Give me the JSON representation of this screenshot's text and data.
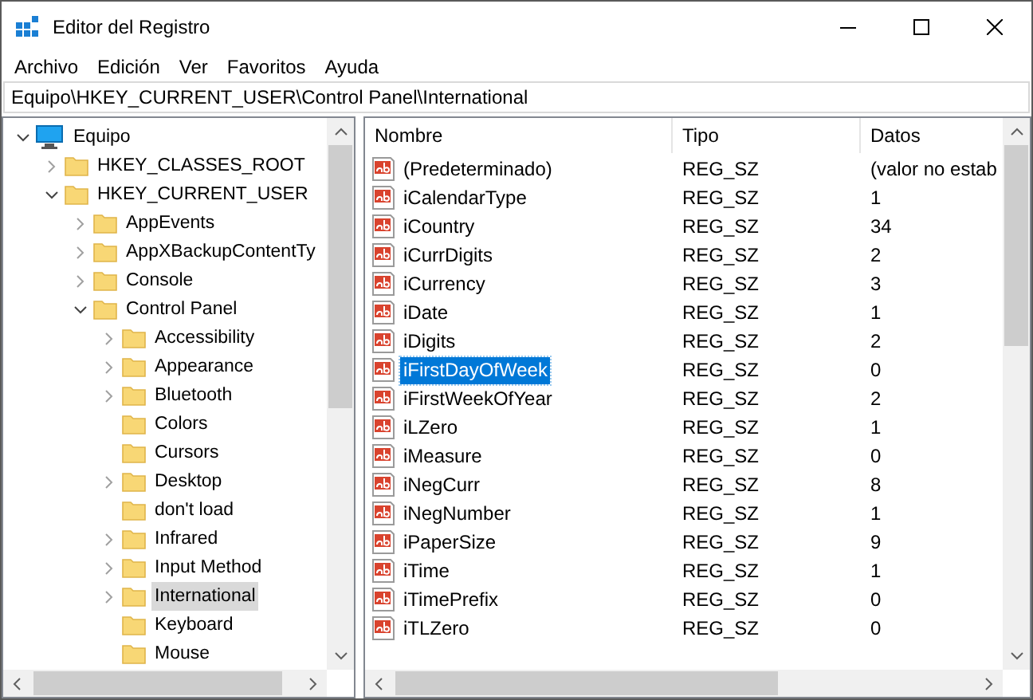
{
  "window": {
    "title": "Editor del Registro"
  },
  "menu": [
    "Archivo",
    "Edición",
    "Ver",
    "Favoritos",
    "Ayuda"
  ],
  "address": "Equipo\\HKEY_CURRENT_USER\\Control Panel\\International",
  "tree": [
    {
      "label": "Equipo",
      "kind": "computer",
      "expanded": true,
      "selected": false,
      "children": [
        {
          "label": "HKEY_CLASSES_ROOT",
          "kind": "folder",
          "expandable": true,
          "expanded": false,
          "selected": false
        },
        {
          "label": "HKEY_CURRENT_USER",
          "kind": "folder",
          "expanded": true,
          "selected": false,
          "children": [
            {
              "label": "AppEvents",
              "kind": "folder",
              "expandable": true,
              "expanded": false,
              "selected": false
            },
            {
              "label": "AppXBackupContentTy",
              "kind": "folder",
              "expandable": true,
              "expanded": false,
              "selected": false
            },
            {
              "label": "Console",
              "kind": "folder",
              "expandable": true,
              "expanded": false,
              "selected": false
            },
            {
              "label": "Control Panel",
              "kind": "folder",
              "expanded": true,
              "selected": false,
              "children": [
                {
                  "label": "Accessibility",
                  "kind": "folder",
                  "expandable": true,
                  "expanded": false,
                  "selected": false
                },
                {
                  "label": "Appearance",
                  "kind": "folder",
                  "expandable": true,
                  "expanded": false,
                  "selected": false
                },
                {
                  "label": "Bluetooth",
                  "kind": "folder",
                  "expandable": true,
                  "expanded": false,
                  "selected": false
                },
                {
                  "label": "Colors",
                  "kind": "folder",
                  "expandable": false,
                  "selected": false
                },
                {
                  "label": "Cursors",
                  "kind": "folder",
                  "expandable": false,
                  "selected": false
                },
                {
                  "label": "Desktop",
                  "kind": "folder",
                  "expandable": true,
                  "expanded": false,
                  "selected": false
                },
                {
                  "label": "don't load",
                  "kind": "folder",
                  "expandable": false,
                  "selected": false
                },
                {
                  "label": "Infrared",
                  "kind": "folder",
                  "expandable": true,
                  "expanded": false,
                  "selected": false
                },
                {
                  "label": "Input Method",
                  "kind": "folder",
                  "expandable": true,
                  "expanded": false,
                  "selected": false
                },
                {
                  "label": "International",
                  "kind": "folder",
                  "expandable": true,
                  "expanded": false,
                  "selected": true
                },
                {
                  "label": "Keyboard",
                  "kind": "folder",
                  "expandable": false,
                  "selected": false
                },
                {
                  "label": "Mouse",
                  "kind": "folder",
                  "expandable": false,
                  "selected": false
                }
              ]
            }
          ]
        }
      ]
    }
  ],
  "values": {
    "columns": [
      "Nombre",
      "Tipo",
      "Datos"
    ],
    "rows": [
      {
        "name": "(Predeterminado)",
        "type": "REG_SZ",
        "data": "(valor no estab",
        "selected": false
      },
      {
        "name": "iCalendarType",
        "type": "REG_SZ",
        "data": "1",
        "selected": false
      },
      {
        "name": "iCountry",
        "type": "REG_SZ",
        "data": "34",
        "selected": false
      },
      {
        "name": "iCurrDigits",
        "type": "REG_SZ",
        "data": "2",
        "selected": false
      },
      {
        "name": "iCurrency",
        "type": "REG_SZ",
        "data": "3",
        "selected": false
      },
      {
        "name": "iDate",
        "type": "REG_SZ",
        "data": "1",
        "selected": false
      },
      {
        "name": "iDigits",
        "type": "REG_SZ",
        "data": "2",
        "selected": false
      },
      {
        "name": "iFirstDayOfWeek",
        "type": "REG_SZ",
        "data": "0",
        "selected": true
      },
      {
        "name": "iFirstWeekOfYear",
        "type": "REG_SZ",
        "data": "2",
        "selected": false
      },
      {
        "name": "iLZero",
        "type": "REG_SZ",
        "data": "1",
        "selected": false
      },
      {
        "name": "iMeasure",
        "type": "REG_SZ",
        "data": "0",
        "selected": false
      },
      {
        "name": "iNegCurr",
        "type": "REG_SZ",
        "data": "8",
        "selected": false
      },
      {
        "name": "iNegNumber",
        "type": "REG_SZ",
        "data": "1",
        "selected": false
      },
      {
        "name": "iPaperSize",
        "type": "REG_SZ",
        "data": "9",
        "selected": false
      },
      {
        "name": "iTime",
        "type": "REG_SZ",
        "data": "1",
        "selected": false
      },
      {
        "name": "iTimePrefix",
        "type": "REG_SZ",
        "data": "0",
        "selected": false
      },
      {
        "name": "iTLZero",
        "type": "REG_SZ",
        "data": "0",
        "selected": false
      }
    ]
  }
}
